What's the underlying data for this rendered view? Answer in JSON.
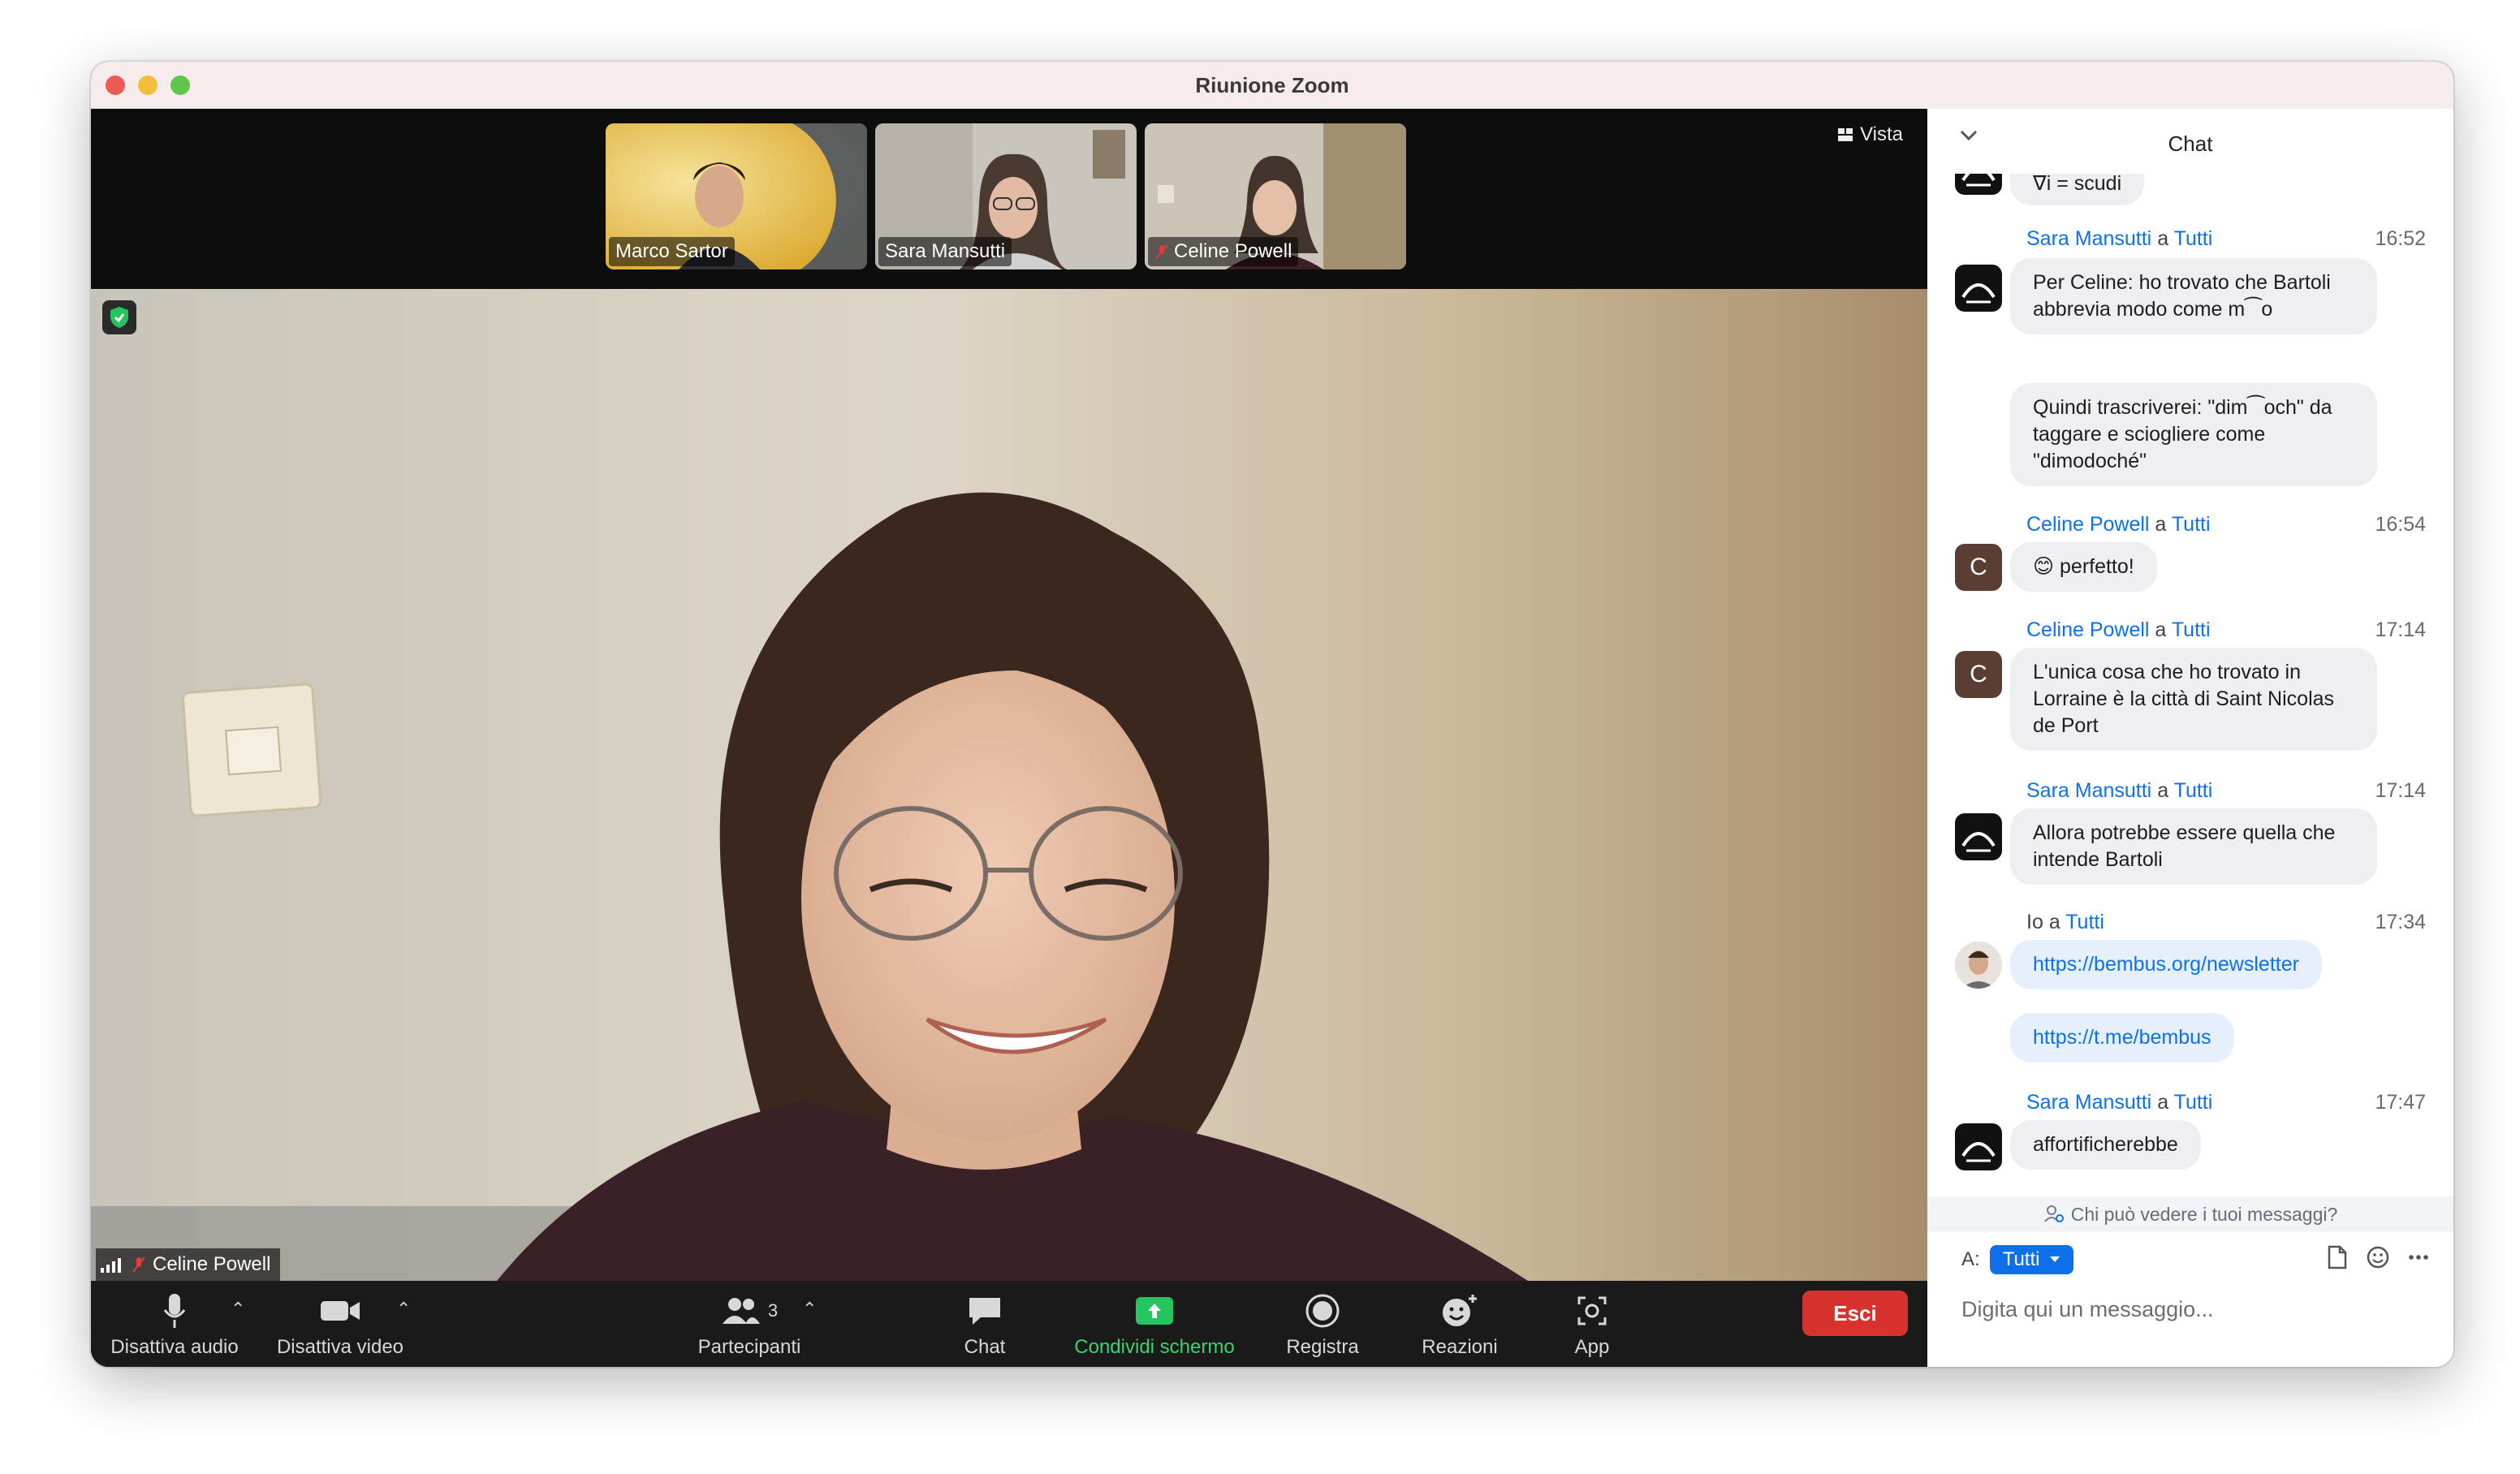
{
  "window": {
    "title": "Riunione Zoom"
  },
  "top_bar": {
    "view_label": "Vista"
  },
  "thumbnails": [
    {
      "name": "Marco Sartor"
    },
    {
      "name": "Sara Mansutti"
    },
    {
      "name": "Celine Powell"
    }
  ],
  "main_video": {
    "speaker_name": "Celine Powell"
  },
  "toolbar": {
    "mute_label": "Disattiva audio",
    "video_label": "Disattiva video",
    "participants_label": "Partecipanti",
    "participants_count": "3",
    "chat_label": "Chat",
    "share_label": "Condividi schermo",
    "record_label": "Registra",
    "reactions_label": "Reazioni",
    "apps_label": "App",
    "leave_label": "Esci"
  },
  "chat": {
    "title": "Chat",
    "partial_message": "∇i = scudi",
    "to_word": "a",
    "messages": [
      {
        "sender": "Sara Mansutti",
        "recipient": "Tutti",
        "time": "16:52",
        "bubbles": [
          "Per Celine: ho trovato che Bartoli abbrevia modo come m⁀o",
          "Quindi trascriverei: \"dim⁀och\" da taggare e sciogliere come \"dimodoché\""
        ]
      },
      {
        "sender": "Celine Powell",
        "recipient": "Tutti",
        "time": "16:54",
        "avatar_letter": "C",
        "bubbles": [
          "😊 perfetto!"
        ]
      },
      {
        "sender": "Celine Powell",
        "recipient": "Tutti",
        "time": "17:14",
        "avatar_letter": "C",
        "bubbles": [
          "L'unica cosa che ho trovato in Lorraine è la città di Saint Nicolas de Port"
        ]
      },
      {
        "sender": "Sara Mansutti",
        "recipient": "Tutti",
        "time": "17:14",
        "bubbles": [
          "Allora potrebbe essere quella che intende Bartoli"
        ]
      },
      {
        "sender": "Io",
        "recipient": "Tutti",
        "time": "17:34",
        "bubbles": [
          "https://bembus.org/newsletter",
          "https://t.me/bembus"
        ]
      },
      {
        "sender": "Sara Mansutti",
        "recipient": "Tutti",
        "time": "17:47",
        "bubbles": [
          "affortificherebbe"
        ]
      }
    ],
    "visibility_notice": "Chi può vedere i tuoi messaggi?",
    "to_label": "A:",
    "to_value": "Tutti",
    "input_placeholder": "Digita qui un messaggio..."
  },
  "colors": {
    "accent": "#0e71eb",
    "leave": "#d7322d",
    "share": "#22c55e",
    "active_border": "#5fd35a"
  }
}
